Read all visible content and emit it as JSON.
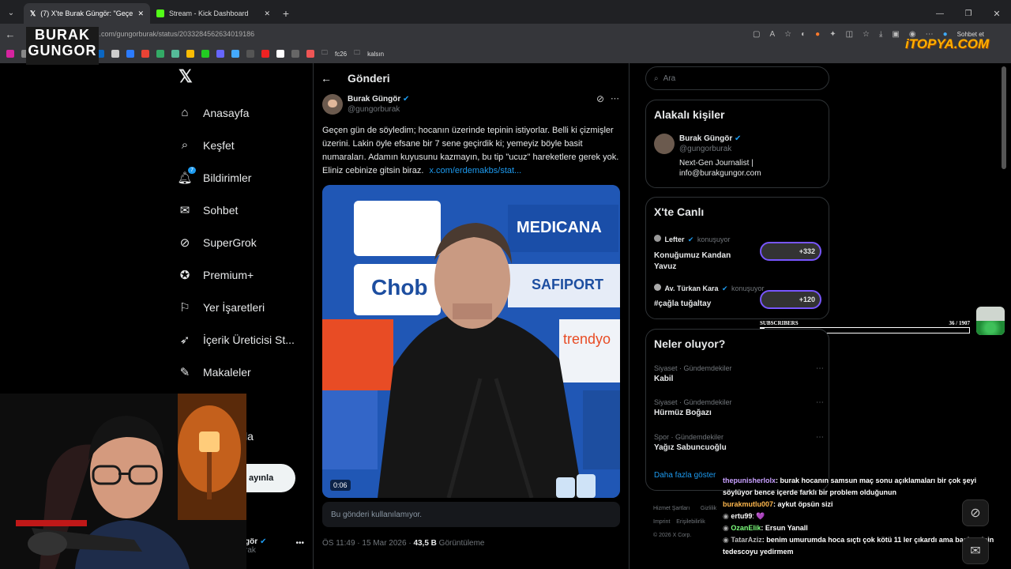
{
  "tabs": [
    {
      "label": "(7) X'te Burak Güngör: \"Geçen gün"
    },
    {
      "label": "Stream - Kick Dashboard"
    }
  ],
  "address": {
    "url": "x.com/gungorburak/status/2033284562634019186",
    "profile_label": "Sohbet et"
  },
  "bookmarks": {
    "folder1": "fc26",
    "folder2": "kalsın"
  },
  "watermarks": {
    "channel_line1": "BURAK",
    "channel_line2": "GUNGOR",
    "brand": "iTOPYA.COM"
  },
  "nav": {
    "home": "Anasayfa",
    "explore": "Keşfet",
    "notifications": "Bildirimler",
    "notif_count": "7",
    "messages": "Sohbet",
    "grok": "SuperGrok",
    "premium": "Premium+",
    "bookmarks": "Yer İşaretleri",
    "creator": "İçerik Üreticisi St...",
    "articles": "Makaleler",
    "more_partial": "la",
    "post_partial": "ayınla",
    "account_partial": "gör",
    "account_handle_partial": "rak"
  },
  "post": {
    "header": "Gönderi",
    "author": "Burak Güngör",
    "handle": "@gungorburak",
    "text": "Geçen gün de söyledim; hocanın üzerinde tepinin istiyorlar. Belli ki çizmişler üzerini. Lakin öyle efsane bir 7 sene geçirdik ki; yemeyiz böyle basit numaraları. Adamın kuyusunu kazmayın, bu tip \"ucuz\" hareketlere gerek yok. Eliniz cebinize gitsin biraz.",
    "link": "x.com/erdemakbs/stat...",
    "video_time": "0:06",
    "unavailable": "Bu gönderi kullanılamıyor.",
    "timestamp": "ÖS 11:49 · 15 Mar 2026 · ",
    "views": "43,5 B",
    "views_label": " Görüntüleme",
    "backdrop": {
      "b1": "MEDICANA",
      "b2": "Chob",
      "b3": "SAFIPORT",
      "b4": "trendyo"
    }
  },
  "right": {
    "search_placeholder": "Ara",
    "related_title": "Alakalı kişiler",
    "related_name": "Burak Güngör",
    "related_handle": "@gungorburak",
    "related_bio": "Next-Gen Journalist | info@burakgungor.com",
    "live_title": "X'te Canlı",
    "live": [
      {
        "host": "Lefter",
        "status": "konuşuyor",
        "title": "Konuğumuz Kandan Yavuz",
        "count": "+332"
      },
      {
        "host": "Av. Türkan Kara",
        "status": "konuşuyor",
        "title": "#çağla tuğaltay",
        "count": "+120"
      }
    ],
    "trends_title": "Neler oluyor?",
    "trends": [
      {
        "category": "Siyaset · Gündemdekiler",
        "name": "Kabil"
      },
      {
        "category": "Siyaset · Gündemdekiler",
        "name": "Hürmüz Boğazı"
      },
      {
        "category": "Spor · Gündemdekiler",
        "name": "Yağız Sabuncuoğlu"
      }
    ],
    "show_more": "Daha fazla göster",
    "footer1": "Hizmet Şartları",
    "footer2": "Gizlilik",
    "footer3": "Imprint",
    "footer4": "Erişilebilirlik",
    "copyright": "© 2026 X Corp."
  },
  "subs": {
    "label": "SUBSCRIBERS",
    "value": "36 / 1907",
    "progress": 0.019
  },
  "chat": [
    {
      "user": "thepunisherlolx",
      "msg": ": burak hocanın samsun maç sonu açıklamaları bir çok şeyi söylüyor bence içerde farklı bir problem olduğunun",
      "color": "#c8a0ff"
    },
    {
      "user": "burakmutlu007",
      "msg": ": aykut öpsün sizi",
      "color": "#ffb84d"
    },
    {
      "user": "ertu99",
      "msg": ": 💜",
      "color": "#ffffff"
    },
    {
      "user": "OzanElik",
      "msg": ": Ersun Yanall",
      "color": "#7dff7d"
    },
    {
      "user": "TatarAziz",
      "msg": ": benim umurumda hoca sıçtı çok kötü 11 ler çıkardı ama başkan için tedescoyu yedirmem",
      "color": "#bbbbbb"
    }
  ],
  "colors": {
    "accent": "#1d9bf0",
    "verified": "#1d9bf0",
    "live_border": "#7856ff"
  }
}
